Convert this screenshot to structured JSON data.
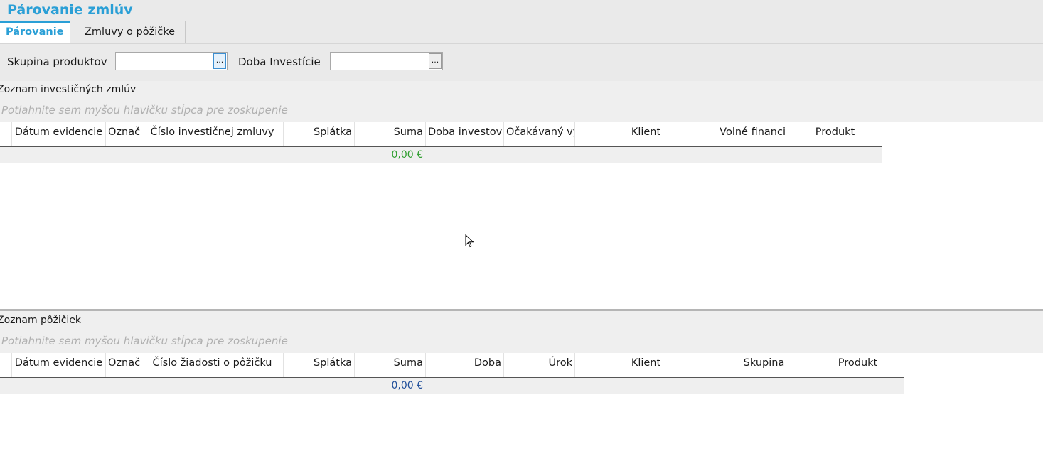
{
  "app": {
    "title": "Párovanie zmlúv"
  },
  "tabs": [
    {
      "label": "Párovanie"
    },
    {
      "label": "Zmluvy o pôžičke"
    }
  ],
  "filters": {
    "product_group_label": "Skupina produktov",
    "product_group_value": "",
    "investment_period_label": "Doba Investície",
    "investment_period_value": "",
    "browse_label": "..."
  },
  "investment_list": {
    "title": "Zoznam investičných zmlúv",
    "group_hint": "Potiahnite sem myšou hlavičku stĺpca pre zoskupenie",
    "columns": [
      "Dátum evidencie",
      "Označ",
      "Číslo investičnej zmluvy",
      "Splátka",
      "Suma",
      "Doba investov",
      "Očakávaný vý",
      "Klient",
      "Volné financi",
      "Produkt"
    ],
    "total": "0,00 €",
    "total_color": "#2e9e2e"
  },
  "loan_list": {
    "title": "Zoznam pôžičiek",
    "group_hint": "Potiahnite sem myšou hlavičku stĺpca pre zoskupenie",
    "columns": [
      "Dátum evidencie",
      "Označ",
      "Číslo žiadosti o pôžičku",
      "Splátka",
      "Suma",
      "Doba",
      "Úrok",
      "Klient",
      "Skupina",
      "Produkt"
    ],
    "total": "0,00 €",
    "total_color": "#1f4e9a"
  },
  "colors": {
    "accent": "#2a9fd6",
    "header_bg": "#eaeaea"
  },
  "icons": {
    "cursor": "mouse-pointer-icon"
  }
}
